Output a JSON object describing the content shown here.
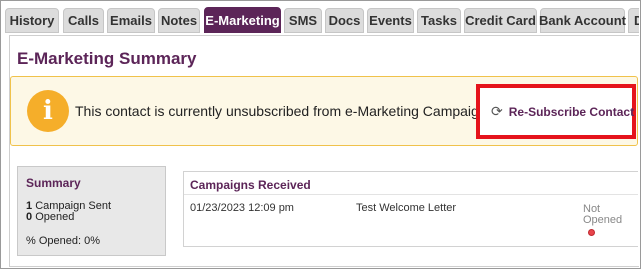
{
  "tabs": [
    {
      "label": "History",
      "active": false
    },
    {
      "label": "Calls",
      "active": false
    },
    {
      "label": "Emails",
      "active": false
    },
    {
      "label": "Notes",
      "active": false
    },
    {
      "label": "E-Marketing",
      "active": true
    },
    {
      "label": "SMS",
      "active": false
    },
    {
      "label": "Docs",
      "active": false
    },
    {
      "label": "Events",
      "active": false
    },
    {
      "label": "Tasks",
      "active": false
    },
    {
      "label": "Credit Card",
      "active": false
    },
    {
      "label": "Bank Account",
      "active": false
    },
    {
      "label": "D",
      "active": false
    }
  ],
  "page": {
    "title": "E-Marketing Summary"
  },
  "alert": {
    "icon": "info-icon",
    "icon_glyph": "i",
    "message": "This contact is currently unsubscribed from e-Marketing Campaigns",
    "button_label": "Re-Subscribe Contact",
    "button_icon": "refresh-icon",
    "button_glyph": "⟳"
  },
  "summary": {
    "title": "Summary",
    "campaigns_sent_count": "1",
    "campaigns_sent_label": "Campaign Sent",
    "opened_count": "0",
    "opened_label": "Opened",
    "percent_opened": "% Opened: 0%"
  },
  "campaigns": {
    "title": "Campaigns Received",
    "rows": [
      {
        "date": "01/23/2023 12:09 pm",
        "name": "Test Welcome Letter",
        "status_line1": "Not",
        "status_line2": "Opened",
        "status_icon": "not-opened-dot-icon"
      }
    ]
  },
  "colors": {
    "brand": "#5c2558",
    "alert_bg": "#fdf8e6",
    "alert_border": "#f0c24b",
    "info_icon": "#f5ae2a",
    "highlight": "#e5131b"
  }
}
